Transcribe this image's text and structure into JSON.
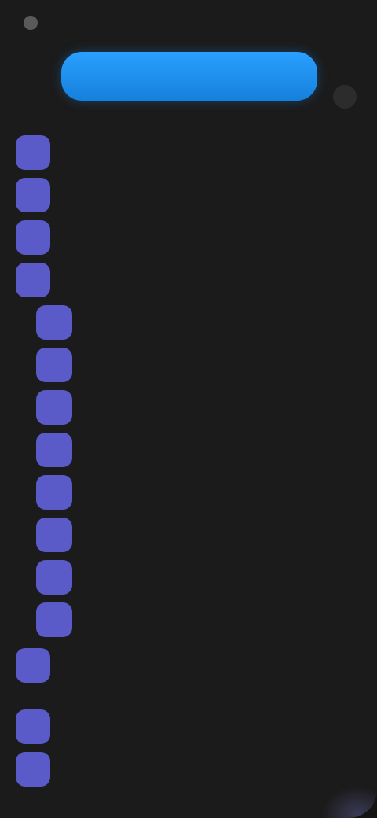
{
  "topbar": {
    "label": ""
  },
  "new_button": {
    "label": ""
  },
  "items": [
    {
      "label": "",
      "level": 1
    },
    {
      "label": "",
      "level": 1
    },
    {
      "label": "",
      "level": 1
    },
    {
      "label": "",
      "level": 1
    },
    {
      "label": "",
      "level": 2
    },
    {
      "label": "",
      "level": 2
    },
    {
      "label": "",
      "level": 2
    },
    {
      "label": "",
      "level": 2
    },
    {
      "label": "",
      "level": 2
    },
    {
      "label": "",
      "level": 2
    },
    {
      "label": "",
      "level": 2
    },
    {
      "label": "",
      "level": 2
    },
    {
      "label": "",
      "level": 1
    },
    {
      "label": "",
      "level": 1
    },
    {
      "label": "",
      "level": 1
    }
  ],
  "colors": {
    "accent": "#1e90f0",
    "icon_fill": "#5a5ac8",
    "background": "#1b1b1b"
  }
}
